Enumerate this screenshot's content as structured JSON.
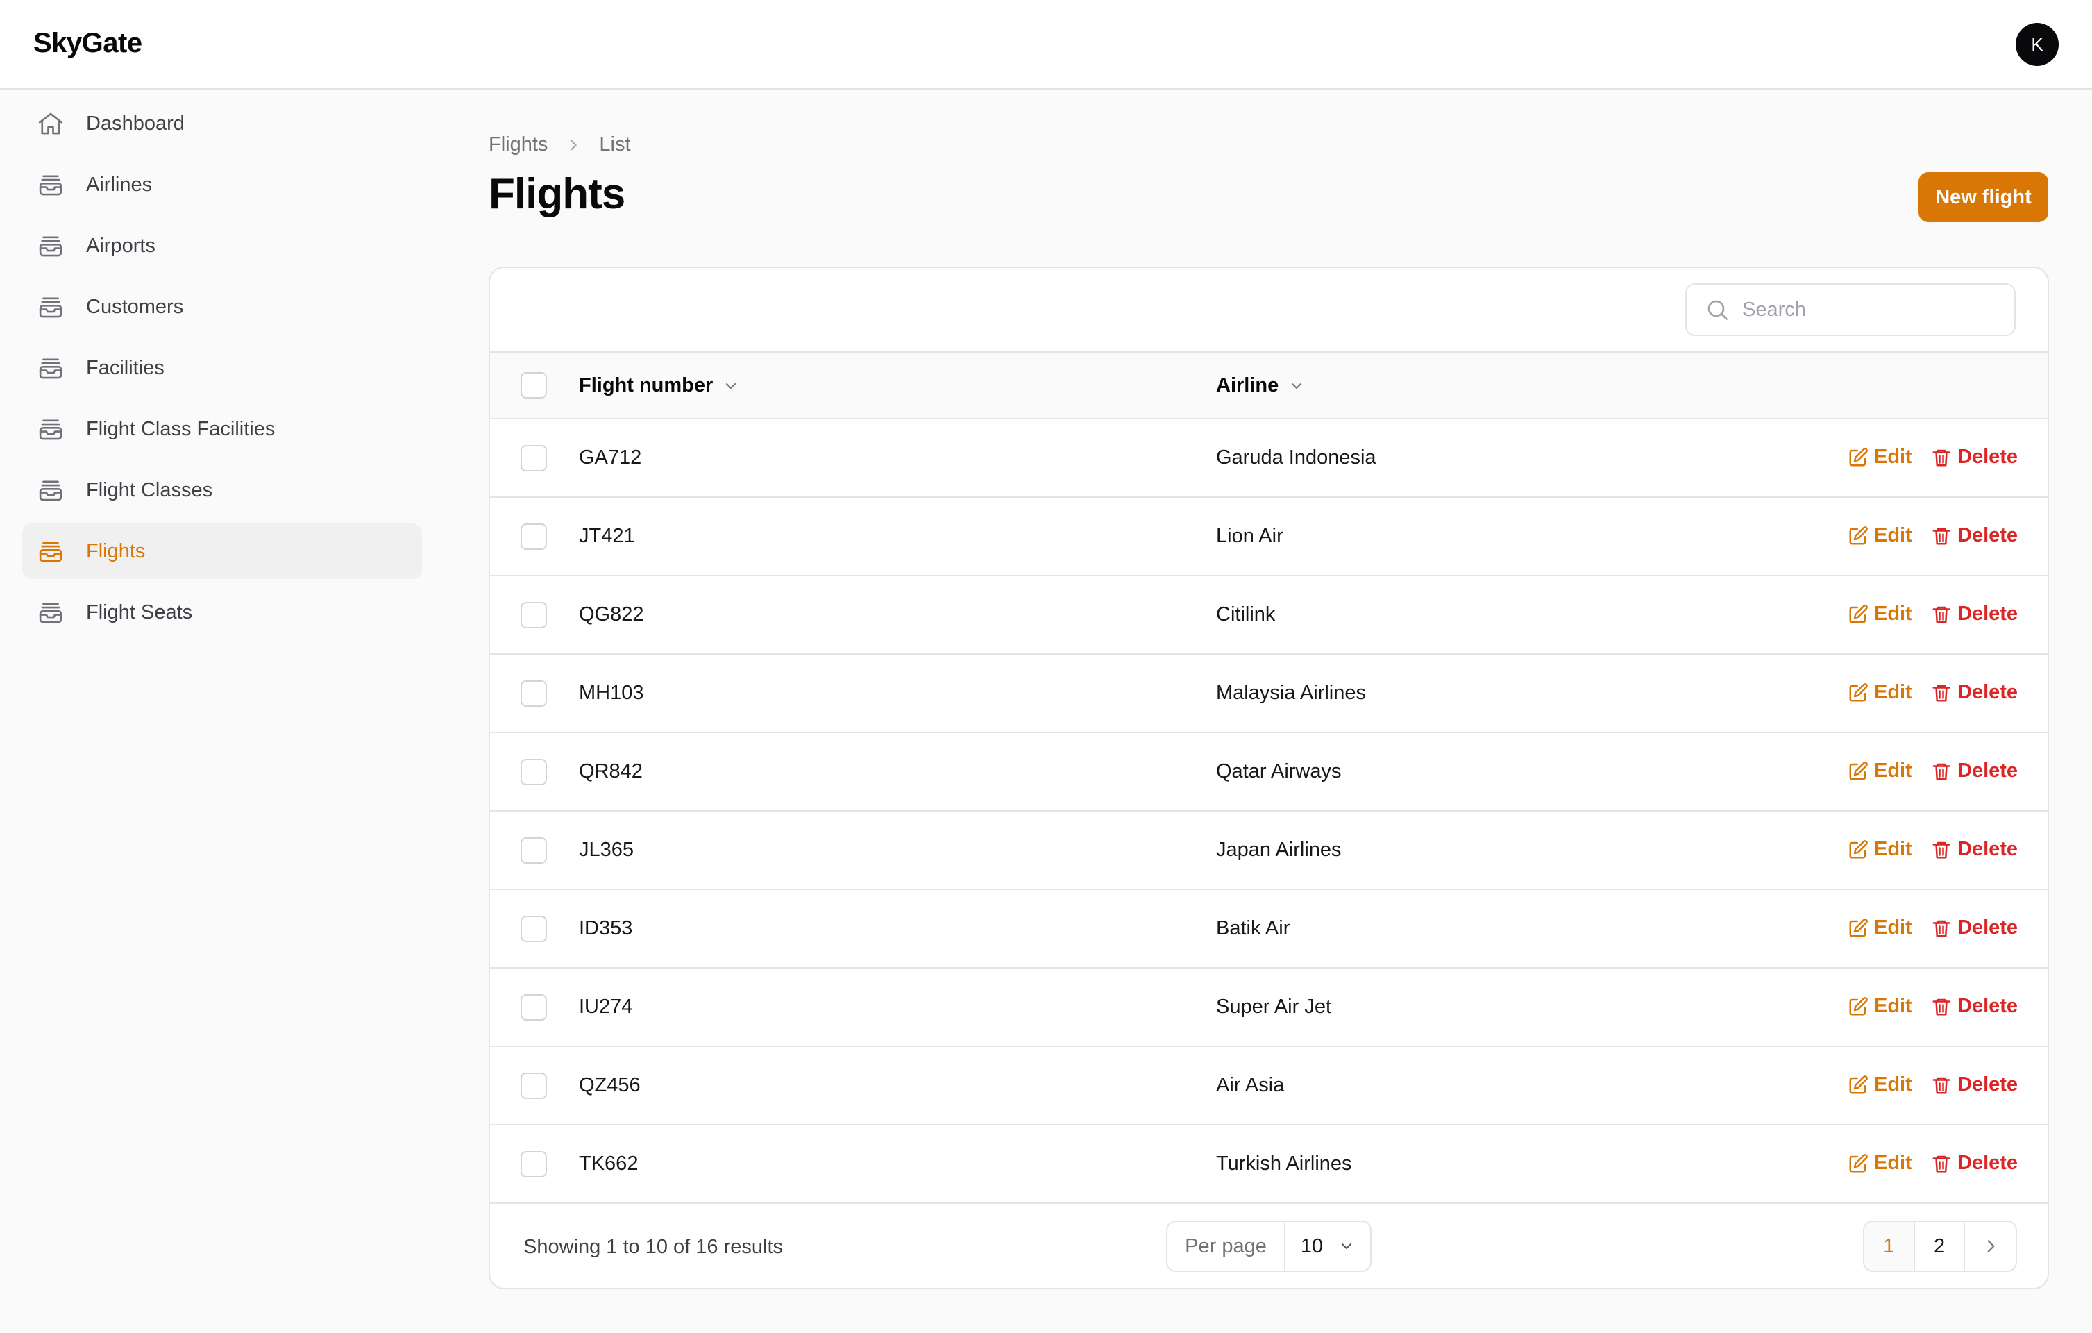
{
  "app": {
    "brand": "SkyGate",
    "avatar_initial": "K"
  },
  "sidebar": {
    "items": [
      {
        "label": "Dashboard",
        "icon": "home-icon",
        "active": false
      },
      {
        "label": "Airlines",
        "icon": "inbox-stack-icon",
        "active": false
      },
      {
        "label": "Airports",
        "icon": "inbox-stack-icon",
        "active": false
      },
      {
        "label": "Customers",
        "icon": "inbox-stack-icon",
        "active": false
      },
      {
        "label": "Facilities",
        "icon": "inbox-stack-icon",
        "active": false
      },
      {
        "label": "Flight Class Facilities",
        "icon": "inbox-stack-icon",
        "active": false
      },
      {
        "label": "Flight Classes",
        "icon": "inbox-stack-icon",
        "active": false
      },
      {
        "label": "Flights",
        "icon": "inbox-stack-icon",
        "active": true
      },
      {
        "label": "Flight Seats",
        "icon": "inbox-stack-icon",
        "active": false
      }
    ]
  },
  "breadcrumb": {
    "parent": "Flights",
    "current": "List"
  },
  "page": {
    "title": "Flights",
    "new_button": "New flight"
  },
  "search": {
    "placeholder": "Search",
    "value": ""
  },
  "table": {
    "columns": {
      "flight_number": "Flight number",
      "airline": "Airline"
    },
    "rows": [
      {
        "flight_number": "GA712",
        "airline": "Garuda Indonesia"
      },
      {
        "flight_number": "JT421",
        "airline": "Lion Air"
      },
      {
        "flight_number": "QG822",
        "airline": "Citilink"
      },
      {
        "flight_number": "MH103",
        "airline": "Malaysia Airlines"
      },
      {
        "flight_number": "QR842",
        "airline": "Qatar Airways"
      },
      {
        "flight_number": "JL365",
        "airline": "Japan Airlines"
      },
      {
        "flight_number": "ID353",
        "airline": "Batik Air"
      },
      {
        "flight_number": "IU274",
        "airline": "Super Air Jet"
      },
      {
        "flight_number": "QZ456",
        "airline": "Air Asia"
      },
      {
        "flight_number": "TK662",
        "airline": "Turkish Airlines"
      }
    ],
    "edit_label": "Edit",
    "delete_label": "Delete"
  },
  "footer": {
    "showing": "Showing 1 to 10 of 16 results",
    "per_page_label": "Per page",
    "per_page_value": "10",
    "pages": [
      "1",
      "2"
    ],
    "current_page": "1"
  },
  "colors": {
    "accent": "#d97706",
    "danger": "#dc2626"
  }
}
